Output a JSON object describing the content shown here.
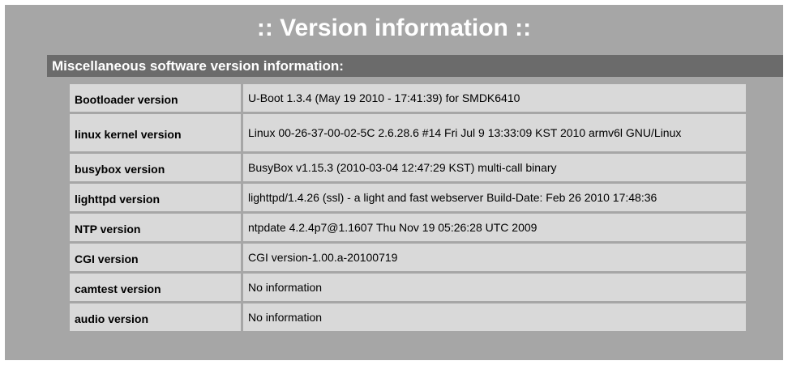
{
  "page": {
    "title": ":: Version information ::"
  },
  "section": {
    "header": "Miscellaneous software version information:"
  },
  "rows": [
    {
      "label": "Bootloader version",
      "value": "U-Boot 1.3.4 (May 19 2010 - 17:41:39) for SMDK6410"
    },
    {
      "label": "linux kernel version",
      "value": "Linux 00-26-37-00-02-5C 2.6.28.6 #14 Fri Jul 9 13:33:09 KST 2010 armv6l GNU/Linux"
    },
    {
      "label": "busybox version",
      "value": "BusyBox v1.15.3 (2010-03-04 12:47:29 KST) multi-call binary"
    },
    {
      "label": "lighttpd version",
      "value": "lighttpd/1.4.26 (ssl) - a light and fast webserver Build-Date: Feb 26 2010 17:48:36"
    },
    {
      "label": "NTP version",
      "value": "ntpdate 4.2.4p7@1.1607 Thu Nov 19 05:26:28 UTC 2009"
    },
    {
      "label": "CGI version",
      "value": "CGI version-1.00.a-20100719"
    },
    {
      "label": "camtest version",
      "value": "No information"
    },
    {
      "label": "audio version",
      "value": "No information"
    }
  ],
  "colors": {
    "panel_background": "#a6a6a6",
    "section_header_background": "#6b6b6b",
    "cell_background": "#d9d9d9",
    "title_text": "#ffffff"
  }
}
